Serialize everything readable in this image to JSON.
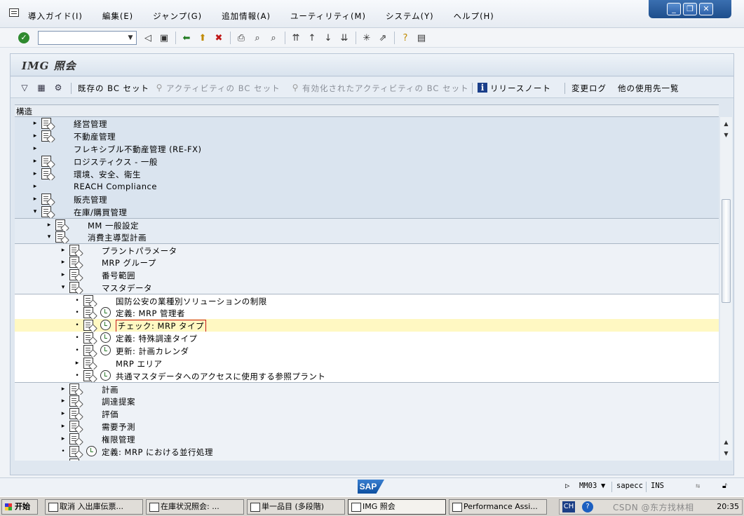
{
  "menubar": {
    "items": [
      "導入ガイド(I)",
      "編集(E)",
      "ジャンプ(G)",
      "追加情報(A)",
      "ユーティリティ(M)",
      "システム(Y)",
      "ヘルプ(H)"
    ],
    "win_minimize": "_",
    "win_restore": "❐",
    "win_close": "✕"
  },
  "toolbar": {
    "command_value": "",
    "check_icon": "✓"
  },
  "panel": {
    "title": "IMG 照会"
  },
  "app_toolbar": {
    "existing_bc_sets": "既存の BC セット",
    "activity_bc_sets": "アクティビティの BC セット",
    "activated_bc_sets": "有効化されたアクティビティの BC セット",
    "release_notes": "リリースノート",
    "change_log": "変更ログ",
    "where_used": "他の使用先一覧",
    "info_icon": "i"
  },
  "tree": {
    "header": "構造",
    "rows": [
      {
        "label": "経営管理",
        "level": 0,
        "expander": "▸",
        "doc": true,
        "clock": false
      },
      {
        "label": "不動産管理",
        "level": 0,
        "expander": "▸",
        "doc": true,
        "clock": false
      },
      {
        "label": "フレキシブル不動産管理 (RE-FX)",
        "level": 0,
        "expander": "▸",
        "doc": false,
        "clock": false
      },
      {
        "label": "ロジスティクス - 一般",
        "level": 0,
        "expander": "▸",
        "doc": true,
        "clock": false
      },
      {
        "label": "環境、安全、衛生",
        "level": 0,
        "expander": "▸",
        "doc": true,
        "clock": false
      },
      {
        "label": "REACH Compliance",
        "level": 0,
        "expander": "▸",
        "doc": false,
        "clock": false
      },
      {
        "label": "販売管理",
        "level": 0,
        "expander": "▸",
        "doc": true,
        "clock": false
      },
      {
        "label": "在庫/購買管理",
        "level": 0,
        "expander": "▾",
        "doc": true,
        "clock": false
      },
      {
        "label": "MM 一般設定",
        "level": 1,
        "expander": "▸",
        "doc": true,
        "clock": false
      },
      {
        "label": "消費主導型計画",
        "level": 1,
        "expander": "▾",
        "doc": true,
        "clock": false
      },
      {
        "label": "プラントパラメータ",
        "level": 2,
        "expander": "▸",
        "doc": true,
        "clock": false
      },
      {
        "label": "MRP グループ",
        "level": 2,
        "expander": "▸",
        "doc": true,
        "clock": false
      },
      {
        "label": "番号範囲",
        "level": 2,
        "expander": "▸",
        "doc": true,
        "clock": false
      },
      {
        "label": "マスタデータ",
        "level": 2,
        "expander": "▾",
        "doc": true,
        "clock": false
      },
      {
        "label": "国防公安の業種別ソリューションの制限",
        "level": 3,
        "expander": "•",
        "doc": true,
        "clock": false
      },
      {
        "label": "定義: MRP 管理者",
        "level": 3,
        "expander": "•",
        "doc": true,
        "clock": true
      },
      {
        "label": "チェック: MRP タイプ",
        "level": 3,
        "expander": "•",
        "doc": true,
        "clock": true,
        "selected": true
      },
      {
        "label": "定義: 特殊調達タイプ",
        "level": 3,
        "expander": "•",
        "doc": true,
        "clock": true
      },
      {
        "label": "更新: 計画カレンダ",
        "level": 3,
        "expander": "•",
        "doc": true,
        "clock": true
      },
      {
        "label": "MRP エリア",
        "level": 3,
        "expander": "▸",
        "doc": true,
        "clock": false
      },
      {
        "label": "共通マスタデータへのアクセスに使用する参照プラント",
        "level": 3,
        "expander": "•",
        "doc": true,
        "clock": true
      },
      {
        "label": "計画",
        "level": 2,
        "expander": "▸",
        "doc": true,
        "clock": false
      },
      {
        "label": "調達提案",
        "level": 2,
        "expander": "▸",
        "doc": true,
        "clock": false
      },
      {
        "label": "評価",
        "level": 2,
        "expander": "▸",
        "doc": true,
        "clock": false
      },
      {
        "label": "需要予測",
        "level": 2,
        "expander": "▸",
        "doc": true,
        "clock": false
      },
      {
        "label": "権限管理",
        "level": 2,
        "expander": "▸",
        "doc": true,
        "clock": false
      },
      {
        "label": "定義: MRP における並行処理",
        "level": 2,
        "expander": "•",
        "doc": true,
        "clock": true
      },
      {
        "label": "",
        "level": 2,
        "expander": "",
        "doc": true,
        "clock": false
      }
    ]
  },
  "statusbar": {
    "sap_logo": "SAP",
    "transaction": "MM03",
    "system": "sapecc",
    "mode": "INS"
  },
  "taskbar": {
    "start": "开始",
    "tasks": [
      "取消 入出庫伝票...",
      "在庫状況照会: ...",
      "単一品目 (多段階)",
      "IMG 照会",
      "Performance Assi..."
    ],
    "active_index": 3,
    "lang": "CH",
    "help": "?",
    "watermark": "CSDN @东方找林相",
    "time": "20:35"
  }
}
